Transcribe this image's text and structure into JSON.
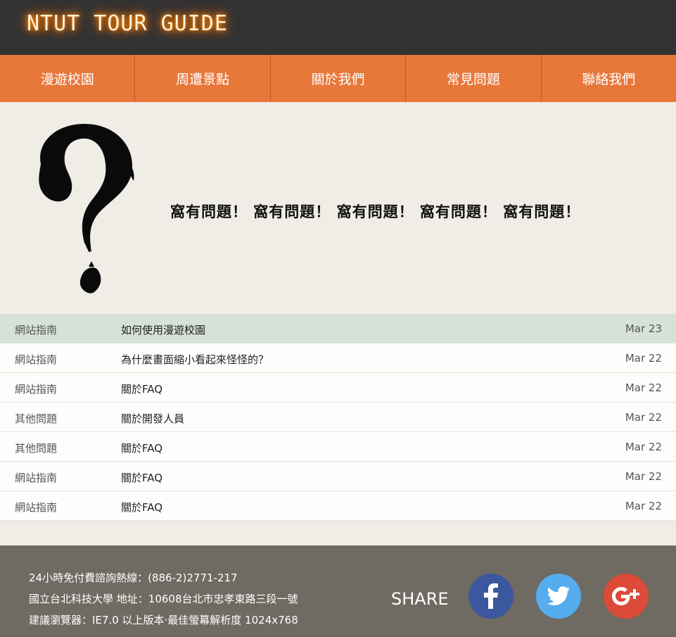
{
  "header": {
    "logo": "NTUT TOUR GUIDE"
  },
  "nav": {
    "items": [
      {
        "label": "漫遊校園"
      },
      {
        "label": "周遭景點"
      },
      {
        "label": "關於我們"
      },
      {
        "label": "常見問題"
      },
      {
        "label": "聯絡我們"
      }
    ]
  },
  "hero": {
    "icon": "question-mark-brush-icon",
    "text": "窩有問題！ 窩有問題！ 窩有問題！ 窩有問題！ 窩有問題！"
  },
  "faq": {
    "rows": [
      {
        "category": "網站指南",
        "title": "如何使用漫遊校園",
        "date": "Mar 23"
      },
      {
        "category": "網站指南",
        "title": "為什麼畫面縮小看起來怪怪的？",
        "date": "Mar 22"
      },
      {
        "category": "網站指南",
        "title": "關於FAQ",
        "date": "Mar 22"
      },
      {
        "category": "其他問題",
        "title": "關於開發人員",
        "date": "Mar 22"
      },
      {
        "category": "其他問題",
        "title": "關於FAQ",
        "date": "Mar 22"
      },
      {
        "category": "網站指南",
        "title": "關於FAQ",
        "date": "Mar 22"
      },
      {
        "category": "網站指南",
        "title": "關於FAQ",
        "date": "Mar 22"
      }
    ]
  },
  "footer": {
    "hotline": "24小時免付費諮詢熱線：(886-2)2771-217",
    "address": "國立台北科技大學 地址：10608台北市忠孝東路三段一號",
    "browser": "建議瀏覽器：IE7.0 以上版本‧最佳螢幕解析度 1024x768",
    "share_label": "SHARE",
    "social": [
      {
        "name": "facebook-icon",
        "color": "#3b579d"
      },
      {
        "name": "twitter-icon",
        "color": "#55acee"
      },
      {
        "name": "google-plus-icon",
        "color": "#dc4a38"
      }
    ]
  }
}
